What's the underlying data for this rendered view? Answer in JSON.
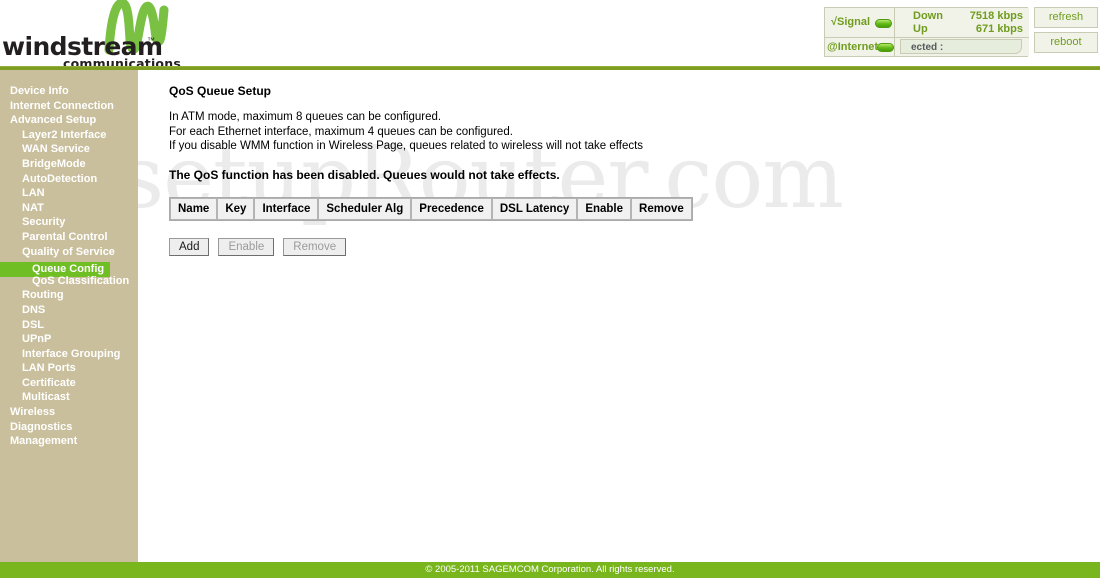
{
  "brand": {
    "wordmark": "windstream",
    "trademark": "™",
    "tagline": "communications",
    "logo_icon": "windstream-wave-logo",
    "mark_color": "#7ac143"
  },
  "status": {
    "signal_label": "√Signal",
    "signal_led": "green-led-on",
    "internet_label": "@Internet",
    "internet_led": "green-led-on",
    "down_label": "Down",
    "down_value": "7518 kbps",
    "up_label": "Up",
    "up_value": "671 kbps",
    "connection_text": "ected :",
    "refresh_label": "refresh",
    "reboot_label": "reboot",
    "accent_color": "#6f9c1f"
  },
  "sidebar": {
    "background_color": "#c9bf9c",
    "selected_color": "#6fbe24",
    "items": [
      {
        "label": "Device Info",
        "level": 0,
        "selected": false
      },
      {
        "label": "Internet Connection",
        "level": 0,
        "selected": false
      },
      {
        "label": "Advanced Setup",
        "level": 0,
        "selected": false
      },
      {
        "label": "Layer2 Interface",
        "level": 1,
        "selected": false
      },
      {
        "label": "WAN Service",
        "level": 1,
        "selected": false
      },
      {
        "label": "BridgeMode",
        "level": 1,
        "selected": false
      },
      {
        "label": "AutoDetection",
        "level": 1,
        "selected": false
      },
      {
        "label": "LAN",
        "level": 1,
        "selected": false
      },
      {
        "label": "NAT",
        "level": 1,
        "selected": false
      },
      {
        "label": "Security",
        "level": 1,
        "selected": false
      },
      {
        "label": "Parental Control",
        "level": 1,
        "selected": false
      },
      {
        "label": "Quality of Service",
        "level": 1,
        "selected": false
      },
      {
        "label": "Queue Config",
        "level": 2,
        "selected": true
      },
      {
        "label": "QoS Classification",
        "level": 2,
        "selected": false
      },
      {
        "label": "Routing",
        "level": 1,
        "selected": false
      },
      {
        "label": "DNS",
        "level": 1,
        "selected": false
      },
      {
        "label": "DSL",
        "level": 1,
        "selected": false
      },
      {
        "label": "UPnP",
        "level": 1,
        "selected": false
      },
      {
        "label": "Interface Grouping",
        "level": 1,
        "selected": false
      },
      {
        "label": "LAN Ports",
        "level": 1,
        "selected": false
      },
      {
        "label": "Certificate",
        "level": 1,
        "selected": false
      },
      {
        "label": "Multicast",
        "level": 1,
        "selected": false
      },
      {
        "label": "Wireless",
        "level": 0,
        "selected": false
      },
      {
        "label": "Diagnostics",
        "level": 0,
        "selected": false
      },
      {
        "label": "Management",
        "level": 0,
        "selected": false
      }
    ]
  },
  "main": {
    "title": "QoS Queue Setup",
    "info_lines": [
      "In ATM mode, maximum 8 queues can be configured.",
      "For each Ethernet interface, maximum 4 queues can be configured.",
      "If you disable WMM function in Wireless Page, queues related to wireless will not take effects"
    ],
    "notice": "The QoS function has been disabled. Queues would not take effects.",
    "table": {
      "columns": [
        "Name",
        "Key",
        "Interface",
        "Scheduler Alg",
        "Precedence",
        "DSL Latency",
        "Enable",
        "Remove"
      ],
      "rows": []
    },
    "buttons": [
      {
        "label": "Add",
        "disabled": false
      },
      {
        "label": "Enable",
        "disabled": true
      },
      {
        "label": "Remove",
        "disabled": true
      }
    ]
  },
  "watermark": "setupRouter.com",
  "footer": {
    "text": "© 2005-2011 SAGEMCOM Corporation. All rights reserved.",
    "background_color": "#79b61d"
  }
}
